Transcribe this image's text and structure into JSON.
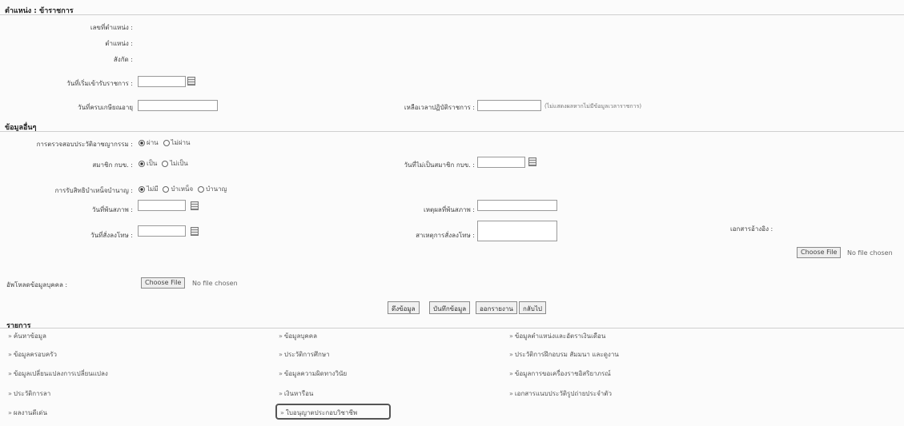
{
  "position_section": {
    "title": "ตำแหน่ง : ข้าราชการ",
    "fields": {
      "position_number_label": "เลขที่ตำแหน่ง :",
      "position_label": "ตำแหน่ง :",
      "affiliation_label": "สังกัด :",
      "start_date_label": "วันที่เริ่มเข้ารับราชการ :",
      "retire_date_label": "วันที่ครบเกษียณอายุ",
      "remaining_service_label": "เหลือเวลาปฏิบัติราชการ :",
      "remaining_service_note": "(ไม่แสดงผลหากไม่มีข้อมูลเวลาราชการ)"
    }
  },
  "other_section": {
    "title": "ข้อมูลอื่นๆ",
    "background_check_label": "การตรวจสอบประวัติอาชญากรรม :",
    "background_check_options": [
      "ผ่าน",
      "ไม่ผ่าน"
    ],
    "union_member_label": "สมาชิก กบข. :",
    "union_member_options": [
      "เป็น",
      "ไม่เป็น"
    ],
    "not_member_date_label": "วันที่ไม่เป็นสมาชิก กบข. :",
    "pension_label": "การรับสิทธิบำเหน็จบำนาญ :",
    "pension_options": [
      "ไม่มี",
      "บำเหน็จ",
      "บำนาญ"
    ],
    "leave_date_label": "วันที่พ้นสภาพ :",
    "leave_reason_label": "เหตุผลที่พ้นสภาพ :",
    "discipline_date_label": "วันที่สั่งลงโทษ :",
    "discipline_reason_label": "สาเหตุการสั่งลงโทษ :",
    "reference_doc_label": "เอกสารอ้างอิง :",
    "choose_file": "Choose File",
    "no_file": "No file chosen",
    "upload_personal_label": "อัพโหลดข้อมูลบุคคล :"
  },
  "actions": {
    "save": "ดึงข้อมูล",
    "record": "บันทึกข้อมูล",
    "report": "ออกรายงาน",
    "back": "กลับไป"
  },
  "list_section": {
    "title": "รายการ",
    "col1": [
      "ค้นหาข้อมูล",
      "ข้อมูลครอบครัว",
      "ข้อมูลเปลี่ยนแปลงการเปลี่ยนแปลง",
      "ประวัติการลา",
      "ผลงานดีเด่น"
    ],
    "col2": [
      "ข้อมูลบุคคล",
      "ประวัติการศึกษา",
      "ข้อมูลความผิดทางวินัย",
      "เงินหารือน",
      "ใบอนุญาตประกอบวิชาชีพ"
    ],
    "col3": [
      "ข้อมูลตำแหน่งและอัตราเงินเดือน",
      "ประวัติการฝึกอบรม สัมมนา และดูงาน",
      "ข้อมูลการขอเครื่องราชอิสริยาภรณ์",
      "เอกสารแนบประวัติรูปถ่ายประจำตัว"
    ]
  }
}
